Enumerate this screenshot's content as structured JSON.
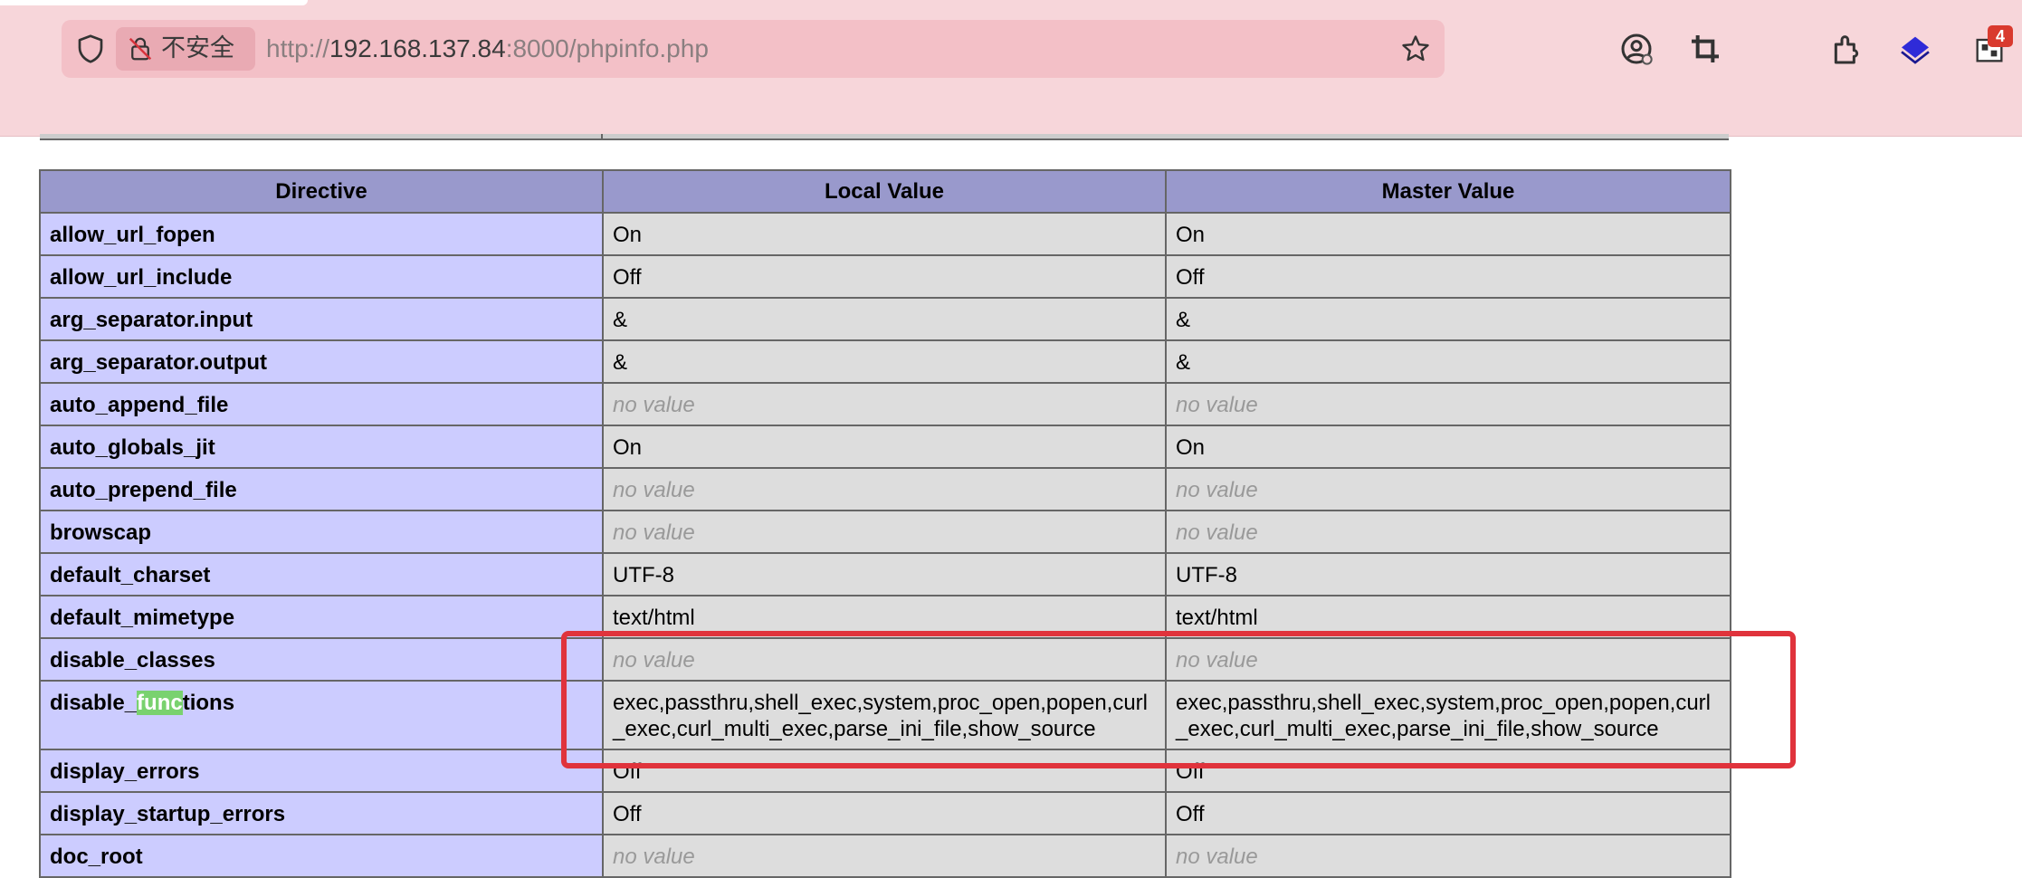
{
  "browser": {
    "security_label": "不安全",
    "url_prefix": "http://",
    "url_host": "192.168.137.84",
    "url_suffix": ":8000/phpinfo.php",
    "extension_badge": "4"
  },
  "table": {
    "headers": [
      "Directive",
      "Local Value",
      "Master Value"
    ],
    "rows": [
      {
        "directive": "allow_url_fopen",
        "local": "On",
        "master": "On"
      },
      {
        "directive": "allow_url_include",
        "local": "Off",
        "master": "Off"
      },
      {
        "directive": "arg_separator.input",
        "local": "&",
        "master": "&"
      },
      {
        "directive": "arg_separator.output",
        "local": "&",
        "master": "&"
      },
      {
        "directive": "auto_append_file",
        "local": "no value",
        "master": "no value"
      },
      {
        "directive": "auto_globals_jit",
        "local": "On",
        "master": "On"
      },
      {
        "directive": "auto_prepend_file",
        "local": "no value",
        "master": "no value"
      },
      {
        "directive": "browscap",
        "local": "no value",
        "master": "no value"
      },
      {
        "directive": "default_charset",
        "local": "UTF-8",
        "master": "UTF-8"
      },
      {
        "directive": "default_mimetype",
        "local": "text/html",
        "master": "text/html"
      },
      {
        "directive": "disable_classes",
        "local": "no value",
        "master": "no value"
      },
      {
        "directive": "disable_functions",
        "directive_pre": "disable_",
        "directive_hl": "func",
        "directive_post": "tions",
        "local": "exec,passthru,shell_exec,system,proc_open,popen,curl_exec,curl_multi_exec,parse_ini_file,show_source",
        "master": "exec,passthru,shell_exec,system,proc_open,popen,curl_exec,curl_multi_exec,parse_ini_file,show_source"
      },
      {
        "directive": "display_errors",
        "local": "Off",
        "master": "Off"
      },
      {
        "directive": "display_startup_errors",
        "local": "Off",
        "master": "Off"
      },
      {
        "directive": "doc_root",
        "local": "no value",
        "master": "no value"
      }
    ]
  },
  "colors": {
    "header_bg": "#9999cc",
    "directive_bg": "#ccccff",
    "value_bg": "#dddddd",
    "annotation": "#e0333c",
    "find_highlight": "#79d26f"
  }
}
